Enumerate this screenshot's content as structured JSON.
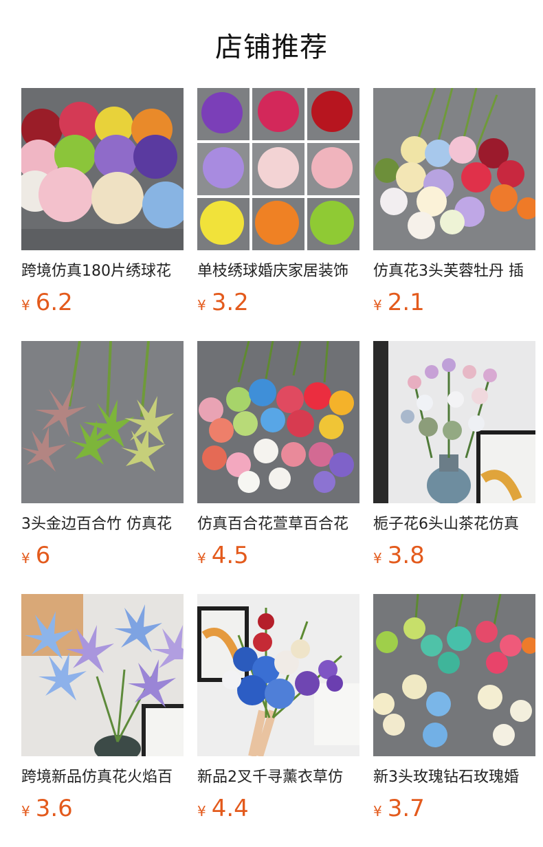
{
  "header": {
    "title": "店铺推荐"
  },
  "products": [
    {
      "title": "跨境仿真180片绣球花",
      "currency": "¥",
      "price": "6.2",
      "image": "hydrangea-color-bundle"
    },
    {
      "title": "单枝绣球婚庆家居装饰",
      "currency": "¥",
      "price": "3.2",
      "image": "hydrangea-color-grid"
    },
    {
      "title": "仿真花3头芙蓉牡丹 插",
      "currency": "¥",
      "price": "2.1",
      "image": "peony-bouquet"
    },
    {
      "title": "3头金边百合竹 仿真花",
      "currency": "¥",
      "price": "6",
      "image": "lily-bamboo-sprays"
    },
    {
      "title": "仿真百合花萱草百合花",
      "currency": "¥",
      "price": "4.5",
      "image": "lily-daylily-spread"
    },
    {
      "title": "栀子花6头山茶花仿真",
      "currency": "¥",
      "price": "3.8",
      "image": "gardenia-camellia-vase"
    },
    {
      "title": "跨境新品仿真花火焰百",
      "currency": "¥",
      "price": "3.6",
      "image": "flame-lily-vase"
    },
    {
      "title": "新品2叉千寻薰衣草仿",
      "currency": "¥",
      "price": "4.4",
      "image": "lavender-bunch"
    },
    {
      "title": "新3头玫瑰钻石玫瑰婚",
      "currency": "¥",
      "price": "3.7",
      "image": "rose-heads-spread"
    }
  ],
  "colors": {
    "price": "#e35a1c",
    "title": "#222222"
  }
}
